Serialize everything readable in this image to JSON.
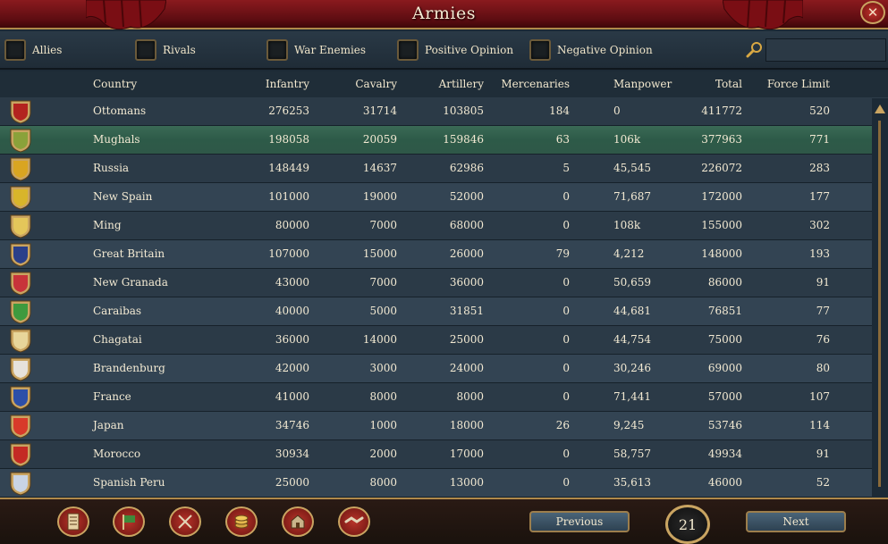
{
  "window": {
    "title": "Armies"
  },
  "filters": [
    {
      "label": "Allies"
    },
    {
      "label": "Rivals"
    },
    {
      "label": "War Enemies"
    },
    {
      "label": "Positive Opinion"
    },
    {
      "label": "Negative Opinion"
    }
  ],
  "search": {
    "value": ""
  },
  "columns": [
    "Country",
    "Infantry",
    "Cavalry",
    "Artillery",
    "Mercenaries",
    "Manpower",
    "Total",
    "Force Limit"
  ],
  "rows": [
    {
      "country": "Ottomans",
      "infantry": "276253",
      "cavalry": "31714",
      "artillery": "103805",
      "mercenaries": "184",
      "manpower": "0",
      "total": "411772",
      "force_limit": "520",
      "flag_color": "#b3231f"
    },
    {
      "country": "Mughals",
      "infantry": "198058",
      "cavalry": "20059",
      "artillery": "159846",
      "mercenaries": "63",
      "manpower": "106k",
      "total": "377963",
      "force_limit": "771",
      "flag_color": "#8aa23a"
    },
    {
      "country": "Russia",
      "infantry": "148449",
      "cavalry": "14637",
      "artillery": "62986",
      "mercenaries": "5",
      "manpower": "45,545",
      "total": "226072",
      "force_limit": "283",
      "flag_color": "#d9a521"
    },
    {
      "country": "New Spain",
      "infantry": "101000",
      "cavalry": "19000",
      "artillery": "52000",
      "mercenaries": "0",
      "manpower": "71,687",
      "total": "172000",
      "force_limit": "177",
      "flag_color": "#d8b52a"
    },
    {
      "country": "Ming",
      "infantry": "80000",
      "cavalry": "7000",
      "artillery": "68000",
      "mercenaries": "0",
      "manpower": "108k",
      "total": "155000",
      "force_limit": "302",
      "flag_color": "#e4c65a"
    },
    {
      "country": "Great Britain",
      "infantry": "107000",
      "cavalry": "15000",
      "artillery": "26000",
      "mercenaries": "79",
      "manpower": "4,212",
      "total": "148000",
      "force_limit": "193",
      "flag_color": "#2a3f8a"
    },
    {
      "country": "New Granada",
      "infantry": "43000",
      "cavalry": "7000",
      "artillery": "36000",
      "mercenaries": "0",
      "manpower": "50,659",
      "total": "86000",
      "force_limit": "91",
      "flag_color": "#c8333a"
    },
    {
      "country": "Caraibas",
      "infantry": "40000",
      "cavalry": "5000",
      "artillery": "31851",
      "mercenaries": "0",
      "manpower": "44,681",
      "total": "76851",
      "force_limit": "77",
      "flag_color": "#3e9a3e"
    },
    {
      "country": "Chagatai",
      "infantry": "36000",
      "cavalry": "14000",
      "artillery": "25000",
      "mercenaries": "0",
      "manpower": "44,754",
      "total": "75000",
      "force_limit": "76",
      "flag_color": "#e8d59a"
    },
    {
      "country": "Brandenburg",
      "infantry": "42000",
      "cavalry": "3000",
      "artillery": "24000",
      "mercenaries": "0",
      "manpower": "30,246",
      "total": "69000",
      "force_limit": "80",
      "flag_color": "#e6e2dc"
    },
    {
      "country": "France",
      "infantry": "41000",
      "cavalry": "8000",
      "artillery": "8000",
      "mercenaries": "0",
      "manpower": "71,441",
      "total": "57000",
      "force_limit": "107",
      "flag_color": "#2d4fa8"
    },
    {
      "country": "Japan",
      "infantry": "34746",
      "cavalry": "1000",
      "artillery": "18000",
      "mercenaries": "26",
      "manpower": "9,245",
      "total": "53746",
      "force_limit": "114",
      "flag_color": "#d83a2a"
    },
    {
      "country": "Morocco",
      "infantry": "30934",
      "cavalry": "2000",
      "artillery": "17000",
      "mercenaries": "0",
      "manpower": "58,757",
      "total": "49934",
      "force_limit": "91",
      "flag_color": "#c42a24"
    },
    {
      "country": "Spanish Peru",
      "infantry": "25000",
      "cavalry": "8000",
      "artillery": "13000",
      "mercenaries": "0",
      "manpower": "35,613",
      "total": "46000",
      "force_limit": "52",
      "flag_color": "#c9d4e4"
    }
  ],
  "pagination": {
    "previous_label": "Previous",
    "next_label": "Next",
    "page": "21"
  },
  "bottom_buttons": [
    {
      "icon": "ledger-icon"
    },
    {
      "icon": "flag-icon"
    },
    {
      "icon": "crossed-swords-icon"
    },
    {
      "icon": "coins-icon"
    },
    {
      "icon": "buildings-icon"
    },
    {
      "icon": "handshake-icon"
    }
  ]
}
